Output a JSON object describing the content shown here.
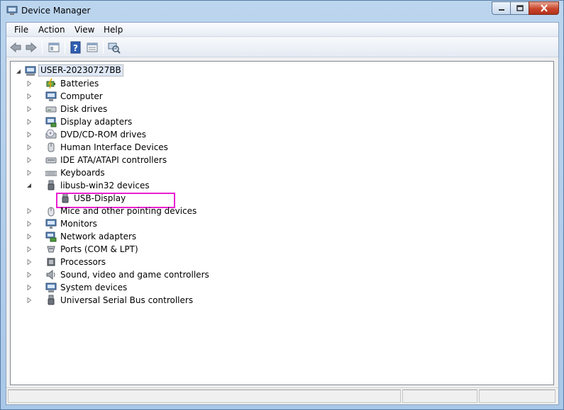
{
  "window": {
    "title": "Device Manager"
  },
  "menu": [
    "File",
    "Action",
    "View",
    "Help"
  ],
  "toolbar": {
    "buttons": [
      "back-icon",
      "forward-icon",
      "properties-icon",
      "help-icon",
      "details-icon",
      "scan-hardware-icon"
    ]
  },
  "tree": {
    "root": "USER-20230727BB",
    "categories": [
      {
        "label": "Batteries",
        "icon": "battery-icon",
        "expanded": false
      },
      {
        "label": "Computer",
        "icon": "computer-icon",
        "expanded": false
      },
      {
        "label": "Disk drives",
        "icon": "disk-drive-icon",
        "expanded": false
      },
      {
        "label": "Display adapters",
        "icon": "display-adapter-icon",
        "expanded": false
      },
      {
        "label": "DVD/CD-ROM drives",
        "icon": "dvd-drive-icon",
        "expanded": false
      },
      {
        "label": "Human Interface Devices",
        "icon": "hid-icon",
        "expanded": false
      },
      {
        "label": "IDE ATA/ATAPI controllers",
        "icon": "ide-controller-icon",
        "expanded": false
      },
      {
        "label": "Keyboards",
        "icon": "keyboard-icon",
        "expanded": false
      },
      {
        "label": "libusb-win32 devices",
        "icon": "usb-plug-icon",
        "expanded": true
      },
      {
        "label": "USB-Display",
        "icon": "usb-plug-icon",
        "child": true,
        "highlighted": true
      },
      {
        "label": "Mice and other pointing devices",
        "icon": "mouse-icon",
        "expanded": false
      },
      {
        "label": "Monitors",
        "icon": "monitor-icon",
        "expanded": false
      },
      {
        "label": "Network adapters",
        "icon": "network-adapter-icon",
        "expanded": false
      },
      {
        "label": "Ports (COM & LPT)",
        "icon": "port-icon",
        "expanded": false
      },
      {
        "label": "Processors",
        "icon": "processor-icon",
        "expanded": false
      },
      {
        "label": "Sound, video and game controllers",
        "icon": "speaker-icon",
        "expanded": false
      },
      {
        "label": "System devices",
        "icon": "system-device-icon",
        "expanded": false
      },
      {
        "label": "Universal Serial Bus controllers",
        "icon": "usb-controller-icon",
        "expanded": false
      }
    ]
  },
  "colors": {
    "highlight": "#e91fd0",
    "titlebar": "#bcd5ee",
    "close_button": "#c9462c"
  }
}
